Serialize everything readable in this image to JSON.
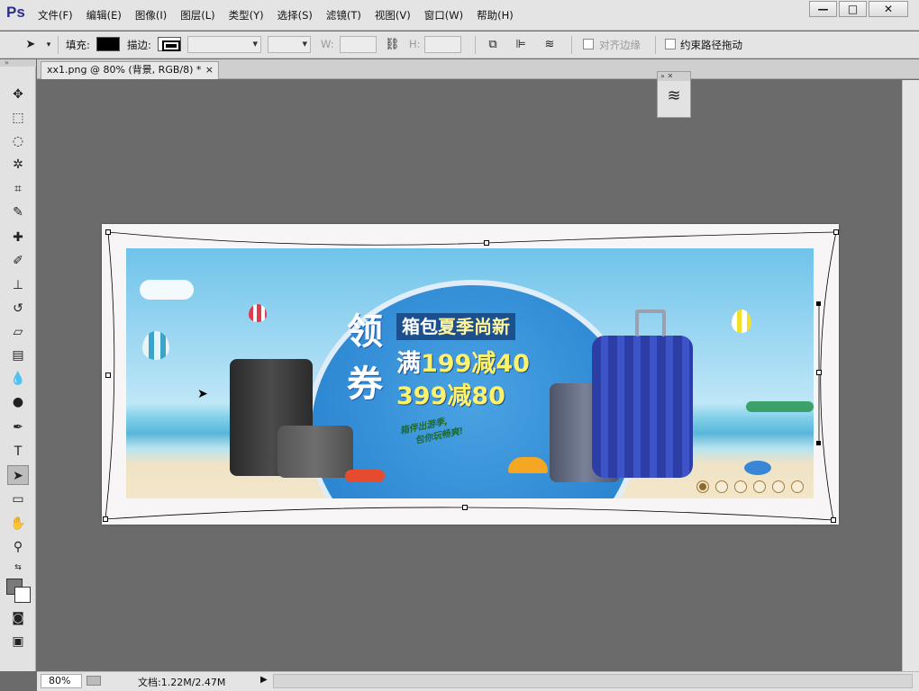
{
  "app": {
    "logo": "Ps",
    "menu": [
      "文件(F)",
      "编辑(E)",
      "图像(I)",
      "图层(L)",
      "类型(Y)",
      "选择(S)",
      "滤镜(T)",
      "视图(V)",
      "窗口(W)",
      "帮助(H)"
    ],
    "window_buttons": {
      "minimize": "—",
      "maximize": "□",
      "close": "✕"
    }
  },
  "options": {
    "fill_label": "填充:",
    "stroke_label": "描边:",
    "w_label": "W:",
    "h_label": "H:",
    "align_edges_label": "对齐边缘",
    "constrain_path_label": "约束路径拖动",
    "fill_color": "#000000"
  },
  "document": {
    "tab_title": "xx1.png @ 80% (背景, RGB/8) *",
    "tab_close": "×",
    "zoom": "80%",
    "doc_info": "文档:1.22M/2.47M"
  },
  "banner": {
    "big_char_1": "领",
    "big_char_2": "券",
    "subtitle_plain": "箱包",
    "subtitle_highlight": "夏季尚新",
    "promo_1_prefix": "满",
    "promo_1_value": "199减40",
    "promo_2_value": "399减80",
    "slogan_line_1": "箱伴出游季,",
    "slogan_line_2": "包你玩畅爽!",
    "carousel_dots": 6,
    "carousel_active_index": 0
  },
  "colors": {
    "menubar_bg": "#e4e4e4",
    "workspace_bg": "#6b6b6b",
    "banner_blue": "#2c86d2",
    "promo_yellow": "#fff26b"
  }
}
